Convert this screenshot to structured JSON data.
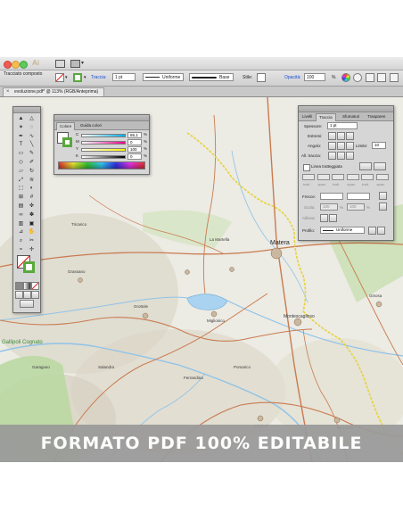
{
  "app": {
    "window_buttons": [
      "close",
      "minimize",
      "zoom"
    ],
    "control_bar": {
      "object_type": "Tracciato composto",
      "stroke_label": "Traccia:",
      "stroke_weight": "1 pt",
      "width_profile": "Uniforme",
      "brush": "Base",
      "style_label": "Stile:",
      "opacity_label": "Opacità:",
      "opacity_value": "100",
      "opacity_unit": "%"
    },
    "document_tab": "evoluzione.pdf* @ 113% (RGB/Anteprima)"
  },
  "color_panel": {
    "tabs": [
      "Colore",
      "Guida colori"
    ],
    "active_tab": "Colore",
    "channels": [
      {
        "name": "C",
        "value": "65,1",
        "unit": "%"
      },
      {
        "name": "M",
        "value": "0",
        "unit": "%"
      },
      {
        "name": "Y",
        "value": "100",
        "unit": "%"
      },
      {
        "name": "K",
        "value": "0",
        "unit": "%"
      }
    ],
    "fill_color": "#58a83c"
  },
  "stroke_panel": {
    "tabs": [
      "Livelli",
      "Traccia",
      "Sfumaturi",
      "Trasparen"
    ],
    "active_tab": "Traccia",
    "weight_label": "Spessore:",
    "weight_value": "1 pt",
    "caps_label": "Estremi:",
    "corner_label": "Angolo:",
    "limit_label": "Limite:",
    "limit_value": "10",
    "align_label": "All. traccia:",
    "dashed_label": "Linea tratteggiata",
    "dash_fields": [
      "tratt.",
      "spaz.",
      "tratt.",
      "spaz.",
      "tratt.",
      "spaz."
    ],
    "arrows_label": "Frecce:",
    "scale_label": "Scala:",
    "scale_values": [
      "100",
      "100"
    ],
    "scale_unit": "%",
    "align_arrows_label": "Allinea:",
    "profile_label": "Profilo:",
    "profile_value": "Uniforme"
  },
  "map": {
    "places": [
      {
        "name": "Matera",
        "major": true
      },
      {
        "name": "Montescaglioso",
        "major": false
      },
      {
        "name": "La Martella",
        "major": false
      },
      {
        "name": "Grottole",
        "major": false
      },
      {
        "name": "Miglionico",
        "major": false
      },
      {
        "name": "Pomarico",
        "major": false
      },
      {
        "name": "Ginosa",
        "major": false
      },
      {
        "name": "Grassano",
        "major": false
      },
      {
        "name": "Salandra",
        "major": false
      },
      {
        "name": "Ferrandina",
        "major": false
      },
      {
        "name": "Pisticci",
        "major": false
      },
      {
        "name": "Bernalda",
        "major": false
      },
      {
        "name": "Tricarico",
        "major": false
      },
      {
        "name": "Garaguso",
        "major": false
      }
    ],
    "park_label": "Gallipoli Cognato"
  },
  "banner": {
    "text": "FORMATO PDF 100% EDITABILE",
    "background": "#9a9a9a",
    "color": "#ffffff"
  },
  "colors": {
    "accent_blue": "#2a66e0",
    "map_land": "#ecebe4",
    "road": "#c97b50",
    "water": "#8fc3e8",
    "park_green": "#8ec07c",
    "border_yellow": "#e8d23a"
  }
}
